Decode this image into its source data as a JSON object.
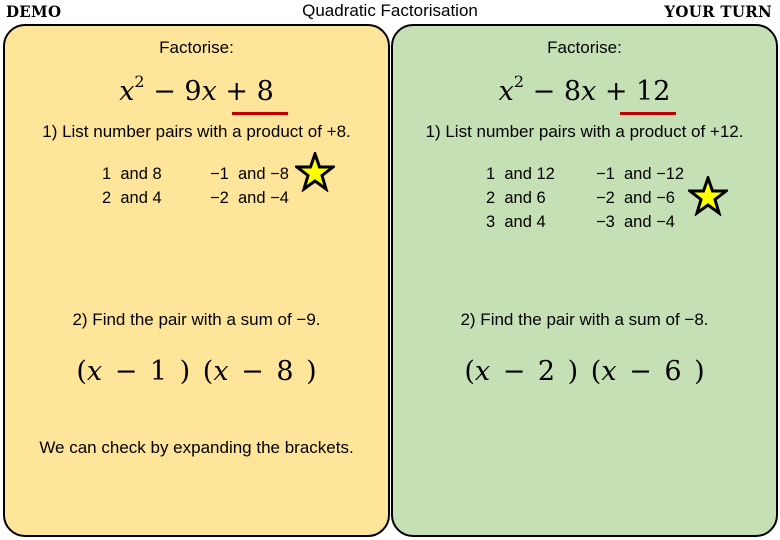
{
  "header": {
    "left_label": "DEMO",
    "title": "Quadratic Factorisation",
    "right_label": "YOUR TURN"
  },
  "colors": {
    "demo_panel": "#ffe599",
    "yourturn_panel": "#c5e0b4",
    "underline": "#c00000",
    "star_fill": "#ffff00"
  },
  "demo": {
    "heading": "Factorise:",
    "expression": {
      "var": "x",
      "power": "2",
      "middle": " − 9",
      "var2": "x",
      "constant_sign": " + ",
      "constant": "8"
    },
    "step1": "1) List number pairs with a product of +8.",
    "pairs_positive": [
      "1  and 8",
      "2  and 4"
    ],
    "pairs_negative": [
      "−1  and −8",
      "−2  and −4"
    ],
    "starred_pair": "−1 and −8",
    "step2": "2) Find the pair with a sum of −9.",
    "answer": {
      "open1": "(",
      "x1": "x",
      "rest1": " − 1 )",
      "open2": " (",
      "x2": "x",
      "rest2": " − 8 )"
    },
    "note": "We can check by expanding the brackets."
  },
  "your_turn": {
    "heading": "Factorise:",
    "expression": {
      "var": "x",
      "power": "2",
      "middle": " − 8",
      "var2": "x",
      "constant_sign": " + ",
      "constant": "12"
    },
    "step1": "1) List number pairs with a product of +12.",
    "pairs_positive": [
      "1  and 12",
      "2  and 6",
      "3  and 4"
    ],
    "pairs_negative": [
      "−1  and −12",
      "−2  and −6",
      "−3  and −4"
    ],
    "starred_pair": "−2 and −6",
    "step2": "2) Find the pair with a sum of −8.",
    "answer": {
      "open1": "(",
      "x1": "x",
      "rest1": " − 2 )",
      "open2": " (",
      "x2": "x",
      "rest2": " − 6 )"
    }
  }
}
